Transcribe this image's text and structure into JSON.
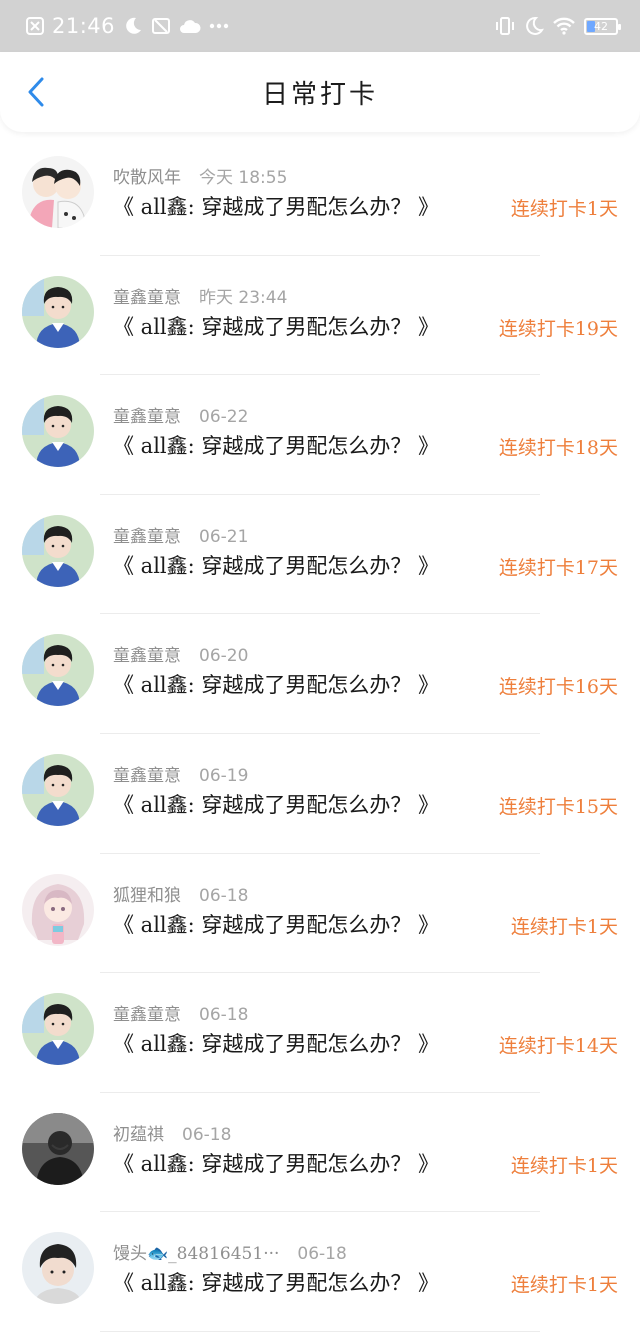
{
  "status_bar": {
    "time": "21:46",
    "battery": "42",
    "icons": [
      "close-box-icon",
      "moon-icon",
      "alarm-off-icon",
      "cloud-icon",
      "more-dots-icon",
      "vibrate-icon",
      "moon-icon",
      "wifi-icon",
      "battery-icon"
    ]
  },
  "header": {
    "title": "日常打卡",
    "back_icon": "chevron-left-icon"
  },
  "colors": {
    "accent": "#2f8bea",
    "streak": "#ee7f3c",
    "status_bar_bg": "#d2d2d2"
  },
  "checkins": [
    {
      "user": "吹散风年",
      "time": "今天 18:55",
      "book": "《 all鑫: 穿越成了男配怎么办？ 》",
      "streak": "连续打卡1天",
      "avatar": "cartoon-couple-avatar"
    },
    {
      "user": "童鑫童意",
      "time": "昨天 23:44",
      "book": "《 all鑫: 穿越成了男配怎么办？ 》",
      "streak": "连续打卡19天",
      "avatar": "boy-blue-sweater-avatar"
    },
    {
      "user": "童鑫童意",
      "time": "06-22",
      "book": "《 all鑫: 穿越成了男配怎么办？ 》",
      "streak": "连续打卡18天",
      "avatar": "boy-blue-sweater-avatar"
    },
    {
      "user": "童鑫童意",
      "time": "06-21",
      "book": "《 all鑫: 穿越成了男配怎么办？ 》",
      "streak": "连续打卡17天",
      "avatar": "boy-blue-sweater-avatar"
    },
    {
      "user": "童鑫童意",
      "time": "06-20",
      "book": "《 all鑫: 穿越成了男配怎么办？ 》",
      "streak": "连续打卡16天",
      "avatar": "boy-blue-sweater-avatar"
    },
    {
      "user": "童鑫童意",
      "time": "06-19",
      "book": "《 all鑫: 穿越成了男配怎么办？ 》",
      "streak": "连续打卡15天",
      "avatar": "boy-blue-sweater-avatar"
    },
    {
      "user": "狐狸和狼",
      "time": "06-18",
      "book": "《 all鑫: 穿越成了男配怎么办？ 》",
      "streak": "连续打卡1天",
      "avatar": "anime-girl-avatar"
    },
    {
      "user": "童鑫童意",
      "time": "06-18",
      "book": "《 all鑫: 穿越成了男配怎么办？ 》",
      "streak": "连续打卡14天",
      "avatar": "boy-blue-sweater-avatar"
    },
    {
      "user": "初蕴祺",
      "time": "06-18",
      "book": "《 all鑫: 穿越成了男配怎么办？ 》",
      "streak": "连续打卡1天",
      "avatar": "dark-photo-avatar"
    },
    {
      "user": "馒头🐟_84816451···",
      "time": "06-18",
      "book": "《 all鑫: 穿越成了男配怎么办？ 》",
      "streak": "连续打卡1天",
      "avatar": "boy-portrait-avatar"
    }
  ]
}
